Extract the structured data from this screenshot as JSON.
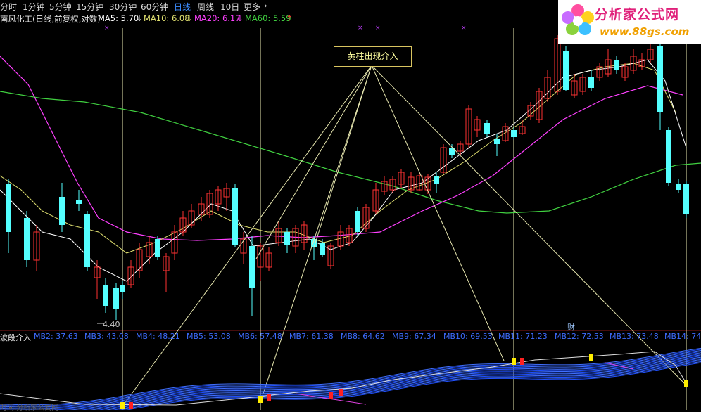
{
  "toolbar": {
    "items": [
      {
        "label": "分时"
      },
      {
        "label": "1分钟"
      },
      {
        "label": "5分钟"
      },
      {
        "label": "15分钟"
      },
      {
        "label": "30分钟"
      },
      {
        "label": "60分钟"
      },
      {
        "label": "日线"
      },
      {
        "label": "周线"
      },
      {
        "label": "10日"
      },
      {
        "label": "更多"
      }
    ],
    "active_label": "日线",
    "more_arrow": "›"
  },
  "main_legend": {
    "title": "南风化工(日线,前复权,对数)",
    "ma5": "MA5: 5.70",
    "ma10": "MA10: 6.08",
    "ma20": "MA20: 6.17",
    "ma60": "MA60: 5.59",
    "arrow_down": "↓",
    "arrow_up": "↑"
  },
  "indicator_legend": {
    "title": "波段介入",
    "items": [
      "MB2: 37.63",
      "MB3: 43.08",
      "MB4: 48.21",
      "MB5: 53.08",
      "MB6: 57.48",
      "MB7: 61.38",
      "MB8: 64.62",
      "MB9: 67.34",
      "MB10: 69.53",
      "MB11: 71.23",
      "MB12: 72.53",
      "MB13: 73.48",
      "MB14: 74"
    ]
  },
  "callout": {
    "text": "黄柱出现介入"
  },
  "price_low_label": "4.40",
  "finance_marker": "财",
  "logo": {
    "title": "分析家公式网",
    "url": "www.88gs.com"
  },
  "footer_text": "时间:分析家公式网",
  "colors": {
    "up": "#ff3232",
    "down": "#54ffff",
    "ma5": "#ffffff",
    "ma10": "#e0e070",
    "ma20": "#ff40ff",
    "ma60": "#40d040",
    "accent": "#3d8cff",
    "callout_border": "#d8c460"
  }
}
